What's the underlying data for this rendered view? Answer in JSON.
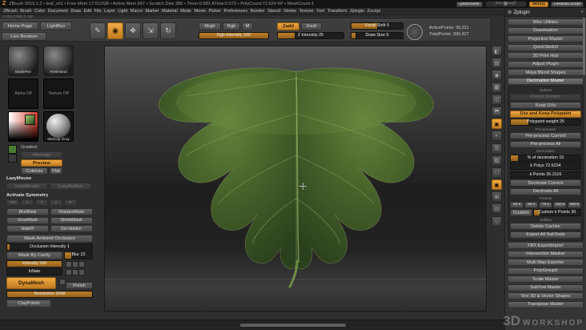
{
  "accent": "#e79a38",
  "title_bar": {
    "app_info": "ZBrush 2019.1.2  •  leaf_v01  •  Free Mem 17.512GB  •  Active Mem 697  •  Scratch Disk 386  •  Timer:0.681 ATime:0.072  •  PolyCount:72.624 KP  •  MeshCount:1",
    "quicksave": "QuickSave",
    "see_through": "See-through",
    "menus": "Menus",
    "default_zscript": "DefaultZScript"
  },
  "menu_bar": {
    "items": [
      {
        "label": "ZBrush"
      },
      {
        "label": "Brush"
      },
      {
        "label": "Color"
      },
      {
        "label": "Document"
      },
      {
        "label": "Draw"
      },
      {
        "label": "Edit"
      },
      {
        "label": "File"
      },
      {
        "label": "Layer"
      },
      {
        "label": "Light"
      },
      {
        "label": "Macro"
      },
      {
        "label": "Marker"
      },
      {
        "label": "Material"
      },
      {
        "label": "Mode"
      },
      {
        "label": "Movie"
      },
      {
        "label": "Picker"
      },
      {
        "label": "Preferences"
      },
      {
        "label": "Render"
      },
      {
        "label": "Stencil"
      },
      {
        "label": "Stroke"
      },
      {
        "label": "Texture"
      },
      {
        "label": "Tool"
      },
      {
        "label": "Transform"
      },
      {
        "label": "Zplugin"
      },
      {
        "label": "Zscript"
      }
    ],
    "picker_values": "0.002,0.982,0.160"
  },
  "toolbar": {
    "home_page": "Home Page",
    "lightbox": "LightBox",
    "live_boolean": "Live Boolean",
    "tools": [
      {
        "label": "Edit",
        "glyph": "✎"
      },
      {
        "label": "Draw",
        "glyph": "◉",
        "active": true
      },
      {
        "label": "Move",
        "glyph": "✥"
      },
      {
        "label": "Scale",
        "glyph": "⇲"
      },
      {
        "label": "Rotate",
        "glyph": "↻"
      }
    ],
    "mrgb": "Mrgb",
    "rgb": "Rgb",
    "m": "M",
    "rgb_intensity": {
      "label": "Rgb Intensity 100",
      "fill": 100
    },
    "zadd": "Zadd",
    "zsub": "Zsub",
    "z_intensity": {
      "label": "Z Intensity 25",
      "fill": 25
    },
    "focal_shift": {
      "label": "Focal Shift 0",
      "fill": 50
    },
    "draw_size": {
      "label": "Draw Size 5",
      "fill": 8
    },
    "active_points": "ActivePoints: 36,311",
    "total_points": "TotalPoints: 390,427"
  },
  "left_panel": {
    "brush": "MaskPen",
    "stroke": "FreeHand",
    "alpha": "Alpha Off",
    "texture": "Texture Off",
    "material": "MatCap Gray",
    "gradient_label": "Gradient",
    "alternate": "Alternate",
    "preview": "Preview",
    "colorize": "Colorize",
    "flat": "Flat",
    "lazymouse_label": "LazyMouse",
    "lazy_buttons": [
      {
        "label": "LazyMouse",
        "dim": true
      },
      {
        "label": "LazyRadius",
        "dim": true
      }
    ],
    "symmetry_label": "Activate Symmetry",
    "symmetry_buttons": [
      {
        "label": ">M<",
        "dim": true
      },
      {
        "label": "X",
        "dim": true
      },
      {
        "label": "Y",
        "dim": true
      },
      {
        "label": "Z",
        "dim": true
      },
      {
        "label": "R",
        "dim": true
      }
    ],
    "mask_buttons": [
      {
        "label": "BlurMask"
      },
      {
        "label": "SharpenMask"
      },
      {
        "label": "GrowMask"
      },
      {
        "label": "ShrinkMask"
      },
      {
        "label": "HidePt"
      },
      {
        "label": "Del Hidden"
      }
    ],
    "mask_ao": "Mask Ambient Occlusion",
    "occlusion_intensity": {
      "label": "Occlusion Intensity 1",
      "fill": 3
    },
    "mask_by_cavity": "Mask By Cavity",
    "blur": {
      "label": "Blur 23",
      "fill": 23
    },
    "intensity": {
      "label": "Intensity 100",
      "fill": 100
    },
    "inflate": {
      "label": "Inflate",
      "fill": 0
    },
    "dynamesh": "DynaMesh",
    "polish": "Polish",
    "resolution": {
      "label": "Resolution 2048",
      "fill": 100
    },
    "claypolish": "ClayPolish"
  },
  "right_shelf": {
    "icons": [
      {
        "name": "bpr-icon",
        "glyph": "◧"
      },
      {
        "name": "scroll-icon",
        "glyph": "▤"
      },
      {
        "name": "zoom-icon",
        "glyph": "◉"
      },
      {
        "name": "actual-icon",
        "glyph": "▦"
      },
      {
        "name": "aahalf-icon",
        "glyph": "◫"
      },
      {
        "name": "persp-icon",
        "glyph": "⬒"
      },
      {
        "name": "floor-icon",
        "glyph": "▣",
        "active": true
      },
      {
        "name": "local-icon",
        "glyph": "◐"
      },
      {
        "name": "lsym-icon",
        "glyph": "☰"
      },
      {
        "name": "transp-icon",
        "glyph": "▨"
      },
      {
        "name": "ghost-icon",
        "glyph": "◻"
      },
      {
        "name": "solo-icon",
        "glyph": "◼",
        "active": true
      },
      {
        "name": "xpose-icon",
        "glyph": "⊞"
      },
      {
        "name": "frame-icon",
        "glyph": "⊡"
      },
      {
        "name": "polyframe-icon",
        "glyph": "◇"
      }
    ]
  },
  "zplugin": {
    "title": "Zplugin",
    "items_top": [
      {
        "label": "Misc Utilities"
      },
      {
        "label": "Deactivation"
      },
      {
        "label": "Projection Master"
      },
      {
        "label": "QuickSketch"
      },
      {
        "label": "3D Print Hub"
      },
      {
        "label": "Adjust Plugin"
      },
      {
        "label": "Maya Blend Shapes"
      },
      {
        "label": "Decimation Master",
        "open": true
      }
    ],
    "decimation": {
      "options_label": "Options",
      "freeze_borders": "Freeze borders",
      "keep_uvs": "Keep UVs",
      "use_keep_polypaint": "Use and Keep Polypaint",
      "polypaint_weight": {
        "label": "Polypaint weight 25",
        "fill": 25
      },
      "preprocess_label": "Pre-process",
      "preprocess_current": "Pre-process Current",
      "preprocess_all": "Pre-process All",
      "decimation_label": "Decimation",
      "pct_decimation": {
        "label": "% of decimation 10",
        "fill": 10
      },
      "k_polys": {
        "label": "k Polys 72.6234",
        "fill": 0
      },
      "k_points": {
        "label": "k Points 36.3116",
        "fill": 0
      },
      "decimate_current": "Decimate Current",
      "decimate_all": "Decimate All",
      "presets_label": "Presets",
      "presets": [
        {
          "label": "20 k"
        },
        {
          "label": "35 k"
        },
        {
          "label": "75 k"
        },
        {
          "label": "150 k"
        },
        {
          "label": "250 k"
        }
      ],
      "custom": "Custom",
      "custom_k_points": {
        "label": "Custom k Points 30",
        "fill": 12
      },
      "utilities_label": "Utilities",
      "delete_caches": "Delete Caches",
      "export_all_subtools": "Export All SubTools"
    },
    "items_bottom": [
      {
        "label": "FBX ExportImport"
      },
      {
        "label": "Intersection Masker"
      },
      {
        "label": "Multi Map Exporter"
      },
      {
        "label": "PolyGroupIt"
      },
      {
        "label": "Scale Master"
      },
      {
        "label": "SubTool Master"
      },
      {
        "label": "Text 3D & Vector Shapes"
      },
      {
        "label": "Transpose Master"
      }
    ]
  },
  "watermark": {
    "line1": "3D",
    "line2": "WORKSHOP"
  }
}
